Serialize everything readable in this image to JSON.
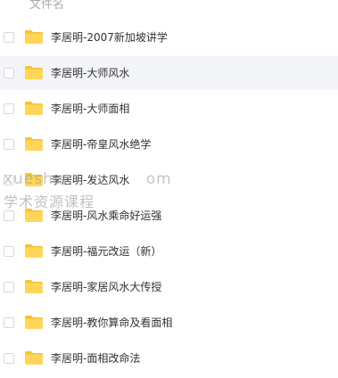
{
  "header": {
    "column_label": "文件名"
  },
  "files": [
    {
      "name": "李居明-2007新加坡讲学"
    },
    {
      "name": "李居明-大师风水"
    },
    {
      "name": "李居明-大师面相"
    },
    {
      "name": "李居明-帝皇风水绝学"
    },
    {
      "name": "李居明-发达风水"
    },
    {
      "name": "李居明-风水乘命好运强"
    },
    {
      "name": "李居明-福元改运（新）"
    },
    {
      "name": "李居明-家居风水大传授"
    },
    {
      "name": "李居明-教你算命及看面相"
    },
    {
      "name": "李居明-面相改命法"
    }
  ],
  "watermark": {
    "line1": "xueshu",
    "line1_tail": "om",
    "line2": "学术资源课程"
  },
  "colors": {
    "folder": "#FFD659",
    "folder_tab": "#F5C335",
    "row_hover": "#F3F5F9"
  }
}
